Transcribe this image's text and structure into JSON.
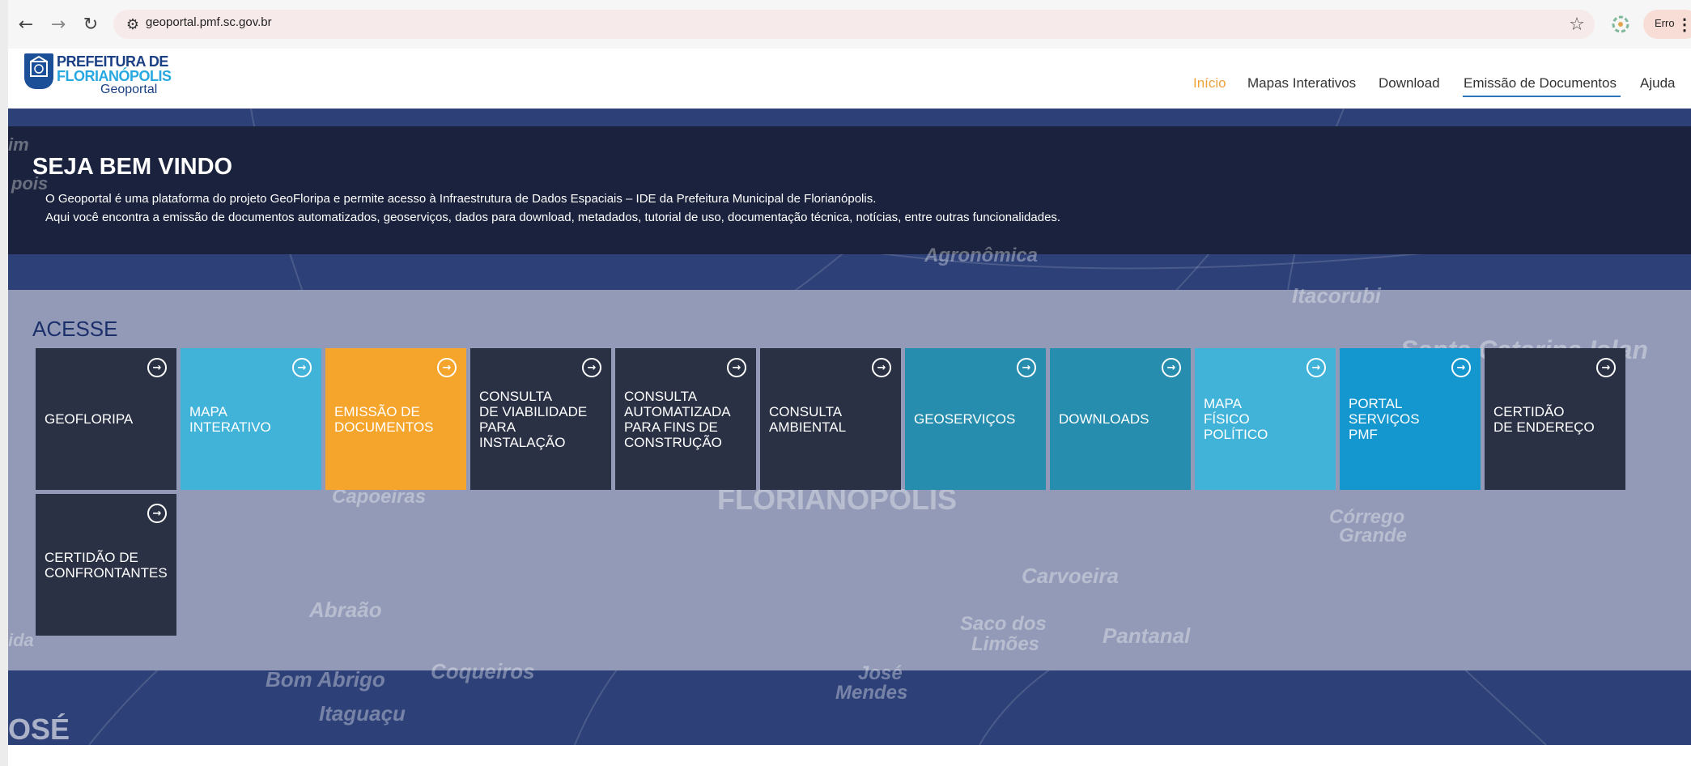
{
  "browser": {
    "url": "geoportal.pmf.sc.gov.br",
    "profile_label": "Erro",
    "icons": {
      "back": "arrow-left-icon",
      "forward": "arrow-right-icon",
      "reload": "reload-icon",
      "site_info": "tune-icon",
      "bookmark": "star-icon",
      "extension": "extension-icon",
      "menu": "kebab-menu-icon"
    }
  },
  "header": {
    "logo": {
      "line1": "PREFEITURA DE",
      "line2": "FLORIANÓPOLIS",
      "line3": "Geoportal"
    },
    "nav": [
      {
        "label": "Início",
        "color": "#f0a23a",
        "active": true
      },
      {
        "label": "Mapas Interativos",
        "color": "#333333"
      },
      {
        "label": "Download",
        "color": "#333333"
      },
      {
        "label": "Emissão de Documentos",
        "color": "#333333",
        "underlined": true
      },
      {
        "label": "Ajuda",
        "color": "#333333"
      }
    ]
  },
  "hero": {
    "title": "SEJA BEM VINDO",
    "line1": "O Geoportal é uma plataforma do projeto GeoFloripa e permite acesso à Infraestrutura de Dados Espaciais – IDE da Prefeitura Municipal de Florianópolis.",
    "line2": "Aqui você encontra a emissão de documentos automatizados, geoserviços, dados para download, metadados, tutorial de uso, documentação técnica, notícias, entre outras funcionalidades.",
    "map_labels": [
      "Agronômica",
      "Itacorubi",
      "Santa Catarina Islan",
      "FLORIANÓPOLIS",
      "Capoeiras",
      "Córrego",
      "Grande",
      "Carvoeira",
      "Abraão",
      "Saco dos",
      "Limões",
      "Pantanal",
      "Bom Abrigo",
      "Coqueiros",
      "José",
      "Mendes",
      "Itaguaçu",
      "OSÉ",
      "ida",
      "im",
      "pois"
    ]
  },
  "acesse": {
    "title": "ACESSE",
    "tiles": [
      {
        "label": "GEOFLORIPA",
        "color": "#2b3145"
      },
      {
        "label": "MAPA\nINTERATIVO",
        "color": "#41b3d9"
      },
      {
        "label": "EMISSÃO DE\nDOCUMENTOS",
        "color": "#f5a52c"
      },
      {
        "label": "CONSULTA\nDE VIABILIDADE\nPARA\nINSTALAÇÃO",
        "color": "#2b3145"
      },
      {
        "label": "CONSULTA\nAUTOMATIZADA\nPARA FINS DE\nCONSTRUÇÃO",
        "color": "#2b3145"
      },
      {
        "label": "CONSULTA\nAMBIENTAL",
        "color": "#2b3145"
      },
      {
        "label": "GEOSERVIÇOS",
        "color": "#268dae"
      },
      {
        "label": "DOWNLOADS",
        "color": "#268dae"
      },
      {
        "label": "MAPA\nFÍSICO\nPOLÍTICO",
        "color": "#41b3d9"
      },
      {
        "label": "PORTAL\nSERVIÇOS\nPMF",
        "color": "#1497cf"
      },
      {
        "label": "CERTIDÃO\nDE ENDEREÇO",
        "color": "#2b3145"
      },
      {
        "label": "CERTIDÃO DE\nCONFRONTANTES",
        "color": "#2b3145"
      }
    ]
  }
}
